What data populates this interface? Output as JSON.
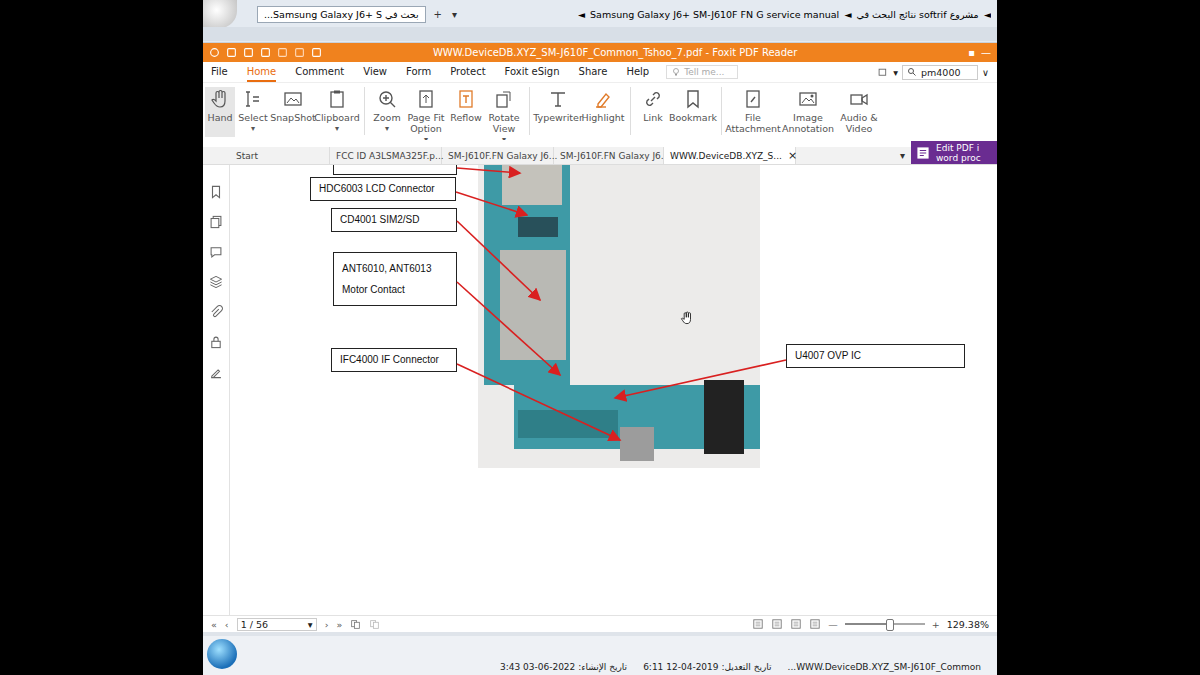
{
  "browser": {
    "tab": {
      "label": "...Samsung Galaxy J6+ S بحث في",
      "selected": true
    },
    "new_tab": "+",
    "tab_menu": "▾",
    "separator": "◄",
    "breadcrumb": [
      "نتائج البحث في softrif مشروع",
      "Samsung Galaxy J6+ SM-J610F FN G service manual"
    ]
  },
  "window": {
    "title": "WWW.DeviceDB.XYZ_SM-J610F_Common_Tshoo_7.pdf - Foxit PDF Reader",
    "controls": [
      "▪",
      "—"
    ]
  },
  "menu": [
    {
      "label": "File",
      "selected": false
    },
    {
      "label": "Home",
      "selected": true
    },
    {
      "label": "Comment",
      "selected": false
    },
    {
      "label": "View",
      "selected": false
    },
    {
      "label": "Form",
      "selected": false
    },
    {
      "label": "Protect",
      "selected": false
    },
    {
      "label": "Foxit eSign",
      "selected": false
    },
    {
      "label": "Share",
      "selected": false
    },
    {
      "label": "Help",
      "selected": false
    }
  ],
  "tell_me": {
    "placeholder": "Tell me..."
  },
  "search": {
    "value": "pm4000",
    "toggle": "▾",
    "menu": "∨"
  },
  "ribbon": [
    {
      "label": "Hand",
      "selected": true,
      "dropdown": false,
      "group": 1
    },
    {
      "label": "Select",
      "selected": false,
      "dropdown": true,
      "group": 1
    },
    {
      "label": "SnapShot",
      "selected": false,
      "dropdown": false,
      "group": 1
    },
    {
      "label": "Clipboard",
      "selected": false,
      "dropdown": true,
      "group": 1
    },
    {
      "label": "Zoom",
      "selected": false,
      "dropdown": true,
      "group": 2
    },
    {
      "label": "Page Fit Option",
      "selected": false,
      "dropdown": true,
      "group": 2
    },
    {
      "label": "Reflow",
      "selected": false,
      "dropdown": false,
      "group": 2
    },
    {
      "label": "Rotate View",
      "selected": false,
      "dropdown": true,
      "group": 2
    },
    {
      "label": "Typewriter",
      "selected": false,
      "dropdown": false,
      "group": 3
    },
    {
      "label": "Highlight",
      "selected": false,
      "dropdown": false,
      "group": 3
    },
    {
      "label": "Link",
      "selected": false,
      "dropdown": false,
      "group": 4
    },
    {
      "label": "Bookmark",
      "selected": false,
      "dropdown": false,
      "group": 4
    },
    {
      "label": "File Attachment",
      "selected": false,
      "dropdown": false,
      "group": 5
    },
    {
      "label": "Image Annotation",
      "selected": false,
      "dropdown": false,
      "group": 5
    },
    {
      "label": "Audio & Video",
      "selected": false,
      "dropdown": false,
      "group": 5
    }
  ],
  "dropdown_mark": "▾",
  "doc_tabs": [
    {
      "label": "Start",
      "selected": false
    },
    {
      "label": "FCC ID A3LSMA325F.p...",
      "selected": false
    },
    {
      "label": "SM-J610F.FN Galaxy J6...",
      "selected": false
    },
    {
      "label": "SM-J610F.FN Galaxy J6...",
      "selected": false
    },
    {
      "label": "WWW.DeviceDB.XYZ_S...",
      "selected": true
    }
  ],
  "tab_close": "×",
  "tabs_menu": "▾",
  "promo": {
    "line1": "Edit PDF i",
    "line2": "word proc"
  },
  "diagram": {
    "labels": [
      {
        "lines": [
          "HDC6003 LCD Connector"
        ]
      },
      {
        "lines": [
          "CD4001 SIM2/SD"
        ]
      },
      {
        "lines": [
          "ANT6010, ANT6013",
          "Motor Contact"
        ]
      },
      {
        "lines": [
          "IFC4000 IF Connector"
        ]
      },
      {
        "lines": [
          "U4007 OVP IC"
        ]
      }
    ]
  },
  "status_bar": {
    "nav": [
      "«",
      "‹",
      "›",
      "»"
    ],
    "page": "1 / 56",
    "page_menu": "▾",
    "zoom_out": "—",
    "zoom_in": "+",
    "zoom_level": 0.56,
    "zoom": "129.38%"
  },
  "details": {
    "name": "...WWW.DeviceDB.XYZ_SM-J610F_Common",
    "modified": "تاريخ التعديل: 2019-04-12 6:11",
    "created": "تاريخ الإنشاء: 2022-06-03 3:43"
  }
}
